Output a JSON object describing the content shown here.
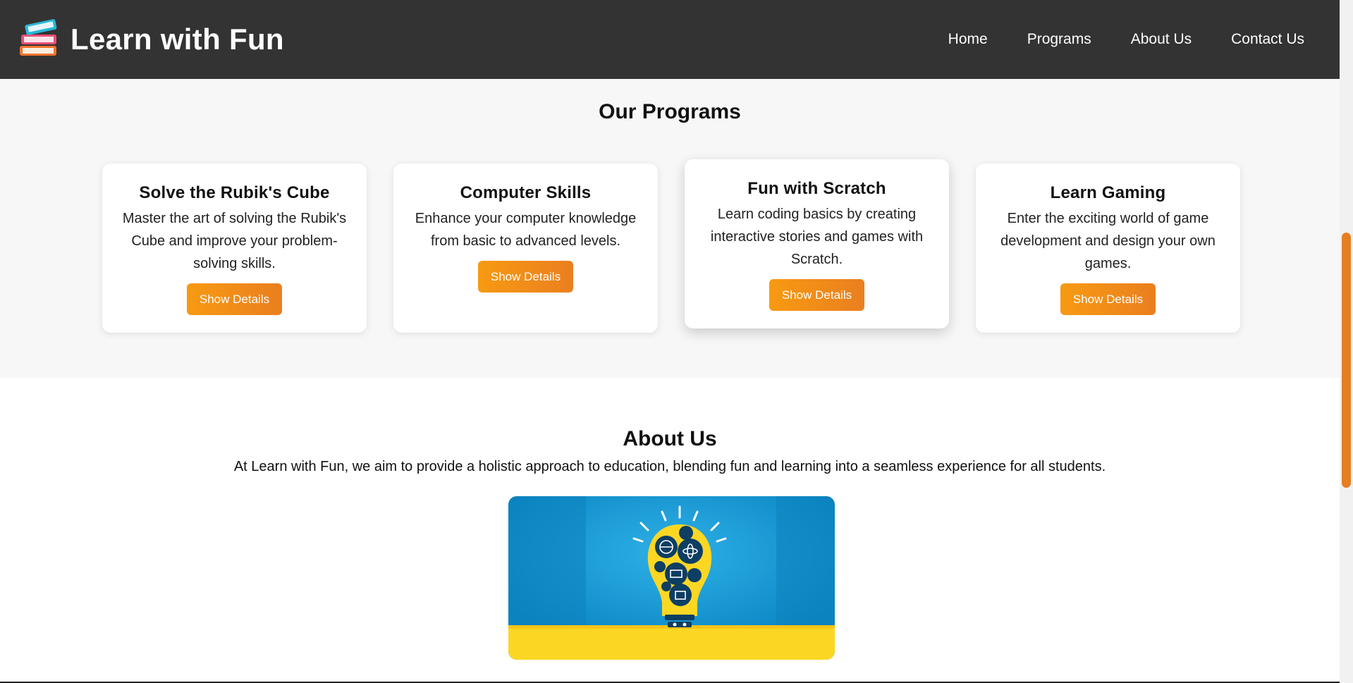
{
  "header": {
    "logo_icon": "books-icon",
    "title": "Learn with Fun",
    "nav": [
      "Home",
      "Programs",
      "About Us",
      "Contact Us"
    ]
  },
  "programs": {
    "title": "Our Programs",
    "cards": [
      {
        "title": "Solve the Rubik's Cube",
        "description": "Master the art of solving the Rubik's Cube and improve your problem-solving skills.",
        "button": "Show Details"
      },
      {
        "title": "Computer Skills",
        "description": "Enhance your computer knowledge from basic to advanced levels.",
        "button": "Show Details"
      },
      {
        "title": "Fun with Scratch",
        "description": "Learn coding basics by creating interactive stories and games with Scratch.",
        "button": "Show Details"
      },
      {
        "title": "Learn Gaming",
        "description": "Enter the exciting world of game development and design your own games.",
        "button": "Show Details"
      }
    ]
  },
  "about": {
    "title": "About Us",
    "text": "At Learn with Fun, we aim to provide a holistic approach to education, blending fun and learning into a seamless experience for all students.",
    "image_icon": "lightbulb-education-illustration"
  },
  "colors": {
    "header_bg": "#333333",
    "accent": "#f28c16",
    "section_bg": "#f7f7f7"
  }
}
